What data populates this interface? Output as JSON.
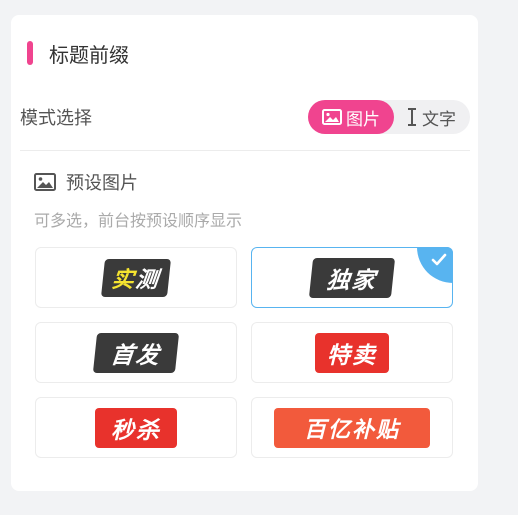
{
  "section": {
    "title": "标题前缀"
  },
  "mode": {
    "label": "模式选择",
    "options": [
      {
        "label": "图片",
        "active": true
      },
      {
        "label": "文字",
        "active": false
      }
    ]
  },
  "preset": {
    "title": "预设图片",
    "hint": "可多选，前台按预设顺序显示",
    "items": [
      {
        "text": "实测",
        "text_parts": [
          "实",
          "测"
        ],
        "selected": false,
        "style": "dark",
        "highlight_color": "#f5e430"
      },
      {
        "text": "独家",
        "selected": true,
        "style": "dark"
      },
      {
        "text": "首发",
        "selected": false,
        "style": "dark"
      },
      {
        "text": "特卖",
        "selected": false,
        "style": "red"
      },
      {
        "text": "秒杀",
        "selected": false,
        "style": "red"
      },
      {
        "text": "百亿补贴",
        "selected": false,
        "style": "orange"
      }
    ]
  },
  "colors": {
    "accent": "#f0448f",
    "selected_border": "#58b4f0"
  }
}
